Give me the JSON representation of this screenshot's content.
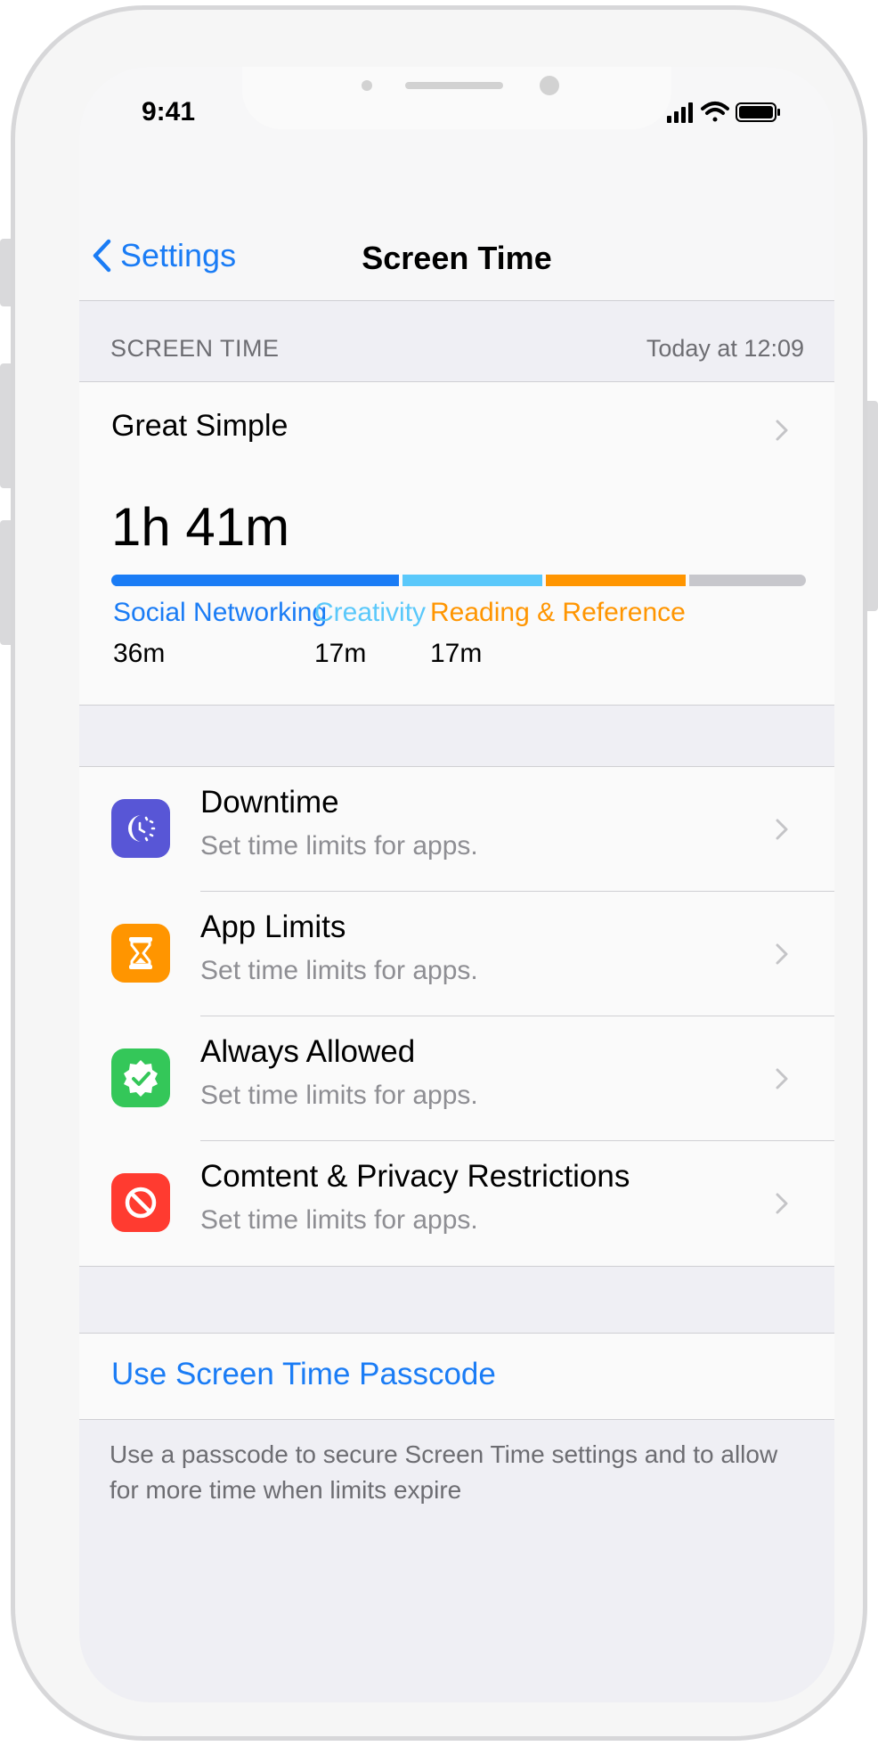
{
  "status_bar": {
    "time": "9:41"
  },
  "nav": {
    "back_label": "Settings",
    "title": "Screen Time"
  },
  "section_header": {
    "label": "SCREEN TIME",
    "timestamp": "Today at 12:09"
  },
  "summary": {
    "device_name": "Great Simple",
    "total": "1h 41m",
    "bar_fractions": [
      0.42,
      0.205,
      0.205,
      0.17
    ],
    "bar_colors": [
      "#1a7cf5",
      "#5ac8fa",
      "#ff9500",
      "#c7c7cc"
    ],
    "categories": [
      {
        "name": "Social Networking",
        "value": "36m",
        "color": "#1a7cf5"
      },
      {
        "name": "Creativity",
        "value": "17m",
        "color": "#5ac8fa"
      },
      {
        "name": "Reading & Reference",
        "value": "17m",
        "color": "#ff9500"
      }
    ]
  },
  "settings_rows": [
    {
      "title": "Downtime",
      "subtitle": "Set time limits for apps.",
      "icon": "downtime-icon",
      "color": "#5856d6"
    },
    {
      "title": "App Limits",
      "subtitle": "Set time limits for apps.",
      "icon": "hourglass-icon",
      "color": "#ff9500"
    },
    {
      "title": "Always Allowed",
      "subtitle": "Set time limits for apps.",
      "icon": "checkmark-seal-icon",
      "color": "#34c759"
    },
    {
      "title": "Comtent & Privacy Restrictions",
      "subtitle": "Set time limits for apps.",
      "icon": "restriction-icon",
      "color": "#ff3b30"
    }
  ],
  "passcode": {
    "label": "Use Screen Time Passcode",
    "footnote": "Use a passcode to secure Screen Time settings and to allow for more time when limits expire"
  }
}
